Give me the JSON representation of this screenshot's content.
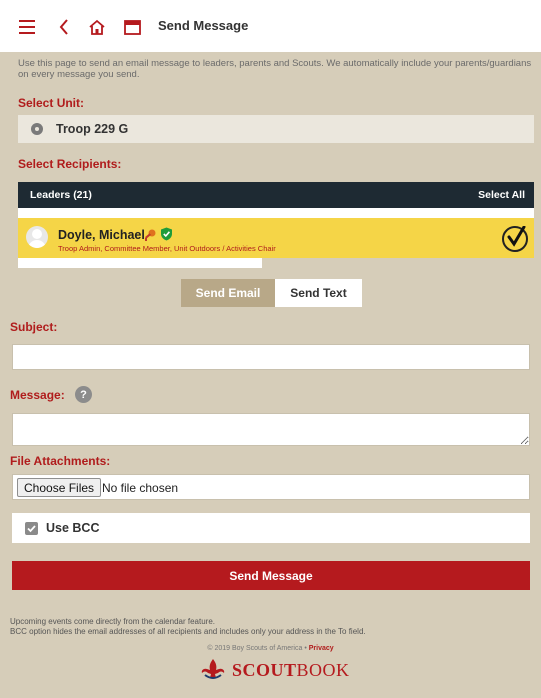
{
  "header": {
    "title": "Send Message"
  },
  "intro": {
    "text": "Use this page to send an email message to leaders, parents and Scouts. We automatically include your parents/guardians on every message you send."
  },
  "unit_section": {
    "label": "Select Unit:",
    "selected_unit": "Troop 229 G"
  },
  "recipients_section": {
    "label": "Select Recipients:",
    "group_title": "Leaders (21)",
    "select_all": "Select All",
    "person": {
      "name": "Doyle, Michael",
      "roles": "Troop Admin, Committee Member, Unit Outdoors / Activities Chair"
    }
  },
  "tabs": {
    "email": "Send Email",
    "text": "Send Text"
  },
  "form": {
    "subject_label": "Subject:",
    "subject_value": "",
    "message_label": "Message:",
    "message_value": "",
    "help_glyph": "?",
    "attachments_label": "File Attachments:",
    "choose_files": "Choose Files",
    "no_file": "No file chosen",
    "bcc_label": "Use BCC",
    "bcc_checked": true,
    "send_button": "Send Message"
  },
  "footer": {
    "note1": "Upcoming events come directly from the calendar feature.",
    "note2": "BCC option hides the email addresses of all recipients and includes only your address in the To field.",
    "copyright": "© 2019 Boy Scouts of America •",
    "privacy": "Privacy",
    "brand_a": "SCOUT",
    "brand_b": "BOOK"
  },
  "colors": {
    "background": "#d6cdb9",
    "accent_red": "#b51a1e",
    "selected_row": "#f5d547",
    "dark_header": "#1e2a33"
  }
}
